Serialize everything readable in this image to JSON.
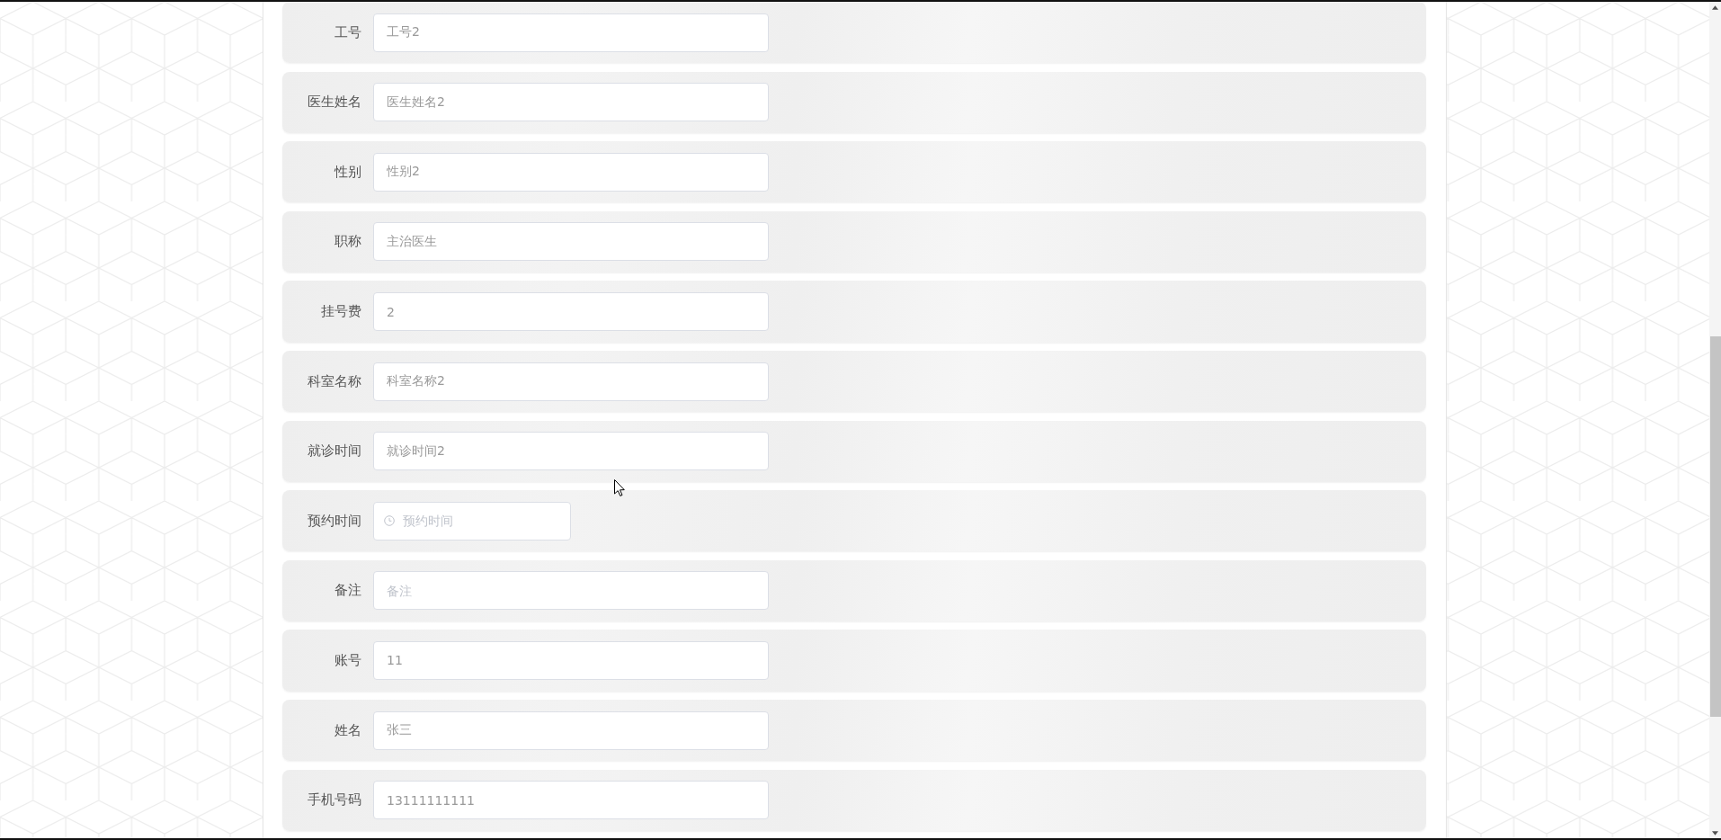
{
  "form": {
    "fields": [
      {
        "kind": "text",
        "label": "工号",
        "value": "工号2"
      },
      {
        "kind": "text",
        "label": "医生姓名",
        "value": "医生姓名2"
      },
      {
        "kind": "text",
        "label": "性别",
        "value": "性别2"
      },
      {
        "kind": "text",
        "label": "职称",
        "value": "主治医生"
      },
      {
        "kind": "text",
        "label": "挂号费",
        "value": "2"
      },
      {
        "kind": "text",
        "label": "科室名称",
        "value": "科室名称2"
      },
      {
        "kind": "text",
        "label": "就诊时间",
        "value": "就诊时间2"
      },
      {
        "kind": "time",
        "label": "预约时间",
        "placeholder": "预约时间"
      },
      {
        "kind": "text",
        "label": "备注",
        "placeholder": "备注"
      },
      {
        "kind": "text",
        "label": "账号",
        "value": "11"
      },
      {
        "kind": "text",
        "label": "姓名",
        "value": "张三"
      },
      {
        "kind": "text",
        "label": "手机号码",
        "value": "13111111111"
      }
    ]
  }
}
